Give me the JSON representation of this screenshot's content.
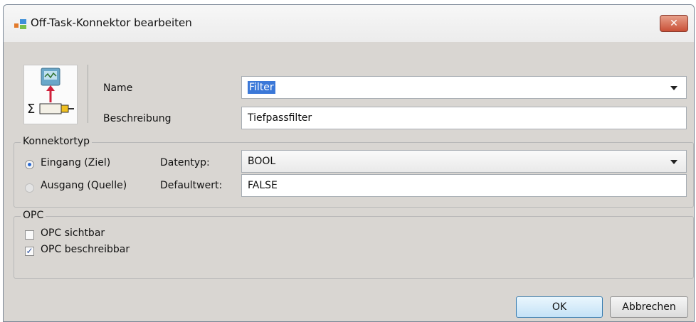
{
  "window": {
    "title": "Off-Task-Konnektor bearbeiten",
    "close_label": "✕"
  },
  "general": {
    "name_label": "Name",
    "name_value": "Filter",
    "description_label": "Beschreibung",
    "description_value": "Tiefpassfilter"
  },
  "connector_type": {
    "group_title": "Konnektortyp",
    "input_label": "Eingang (Ziel)",
    "output_label": "Ausgang (Quelle)",
    "selected": "input",
    "datatype_label": "Datentyp:",
    "datatype_value": "BOOL",
    "default_label": "Defaultwert:",
    "default_value": "FALSE"
  },
  "opc": {
    "group_title": "OPC",
    "visible_label": "OPC sichtbar",
    "visible_checked": false,
    "writable_label": "OPC beschreibbar",
    "writable_checked": true
  },
  "buttons": {
    "ok_label": "OK",
    "cancel_label": "Abbrechen"
  },
  "icons": {
    "title": "connector-window-icon",
    "dialog": "off-task-connector-icon",
    "close": "close-icon",
    "dropdown": "chevron-down-icon"
  }
}
